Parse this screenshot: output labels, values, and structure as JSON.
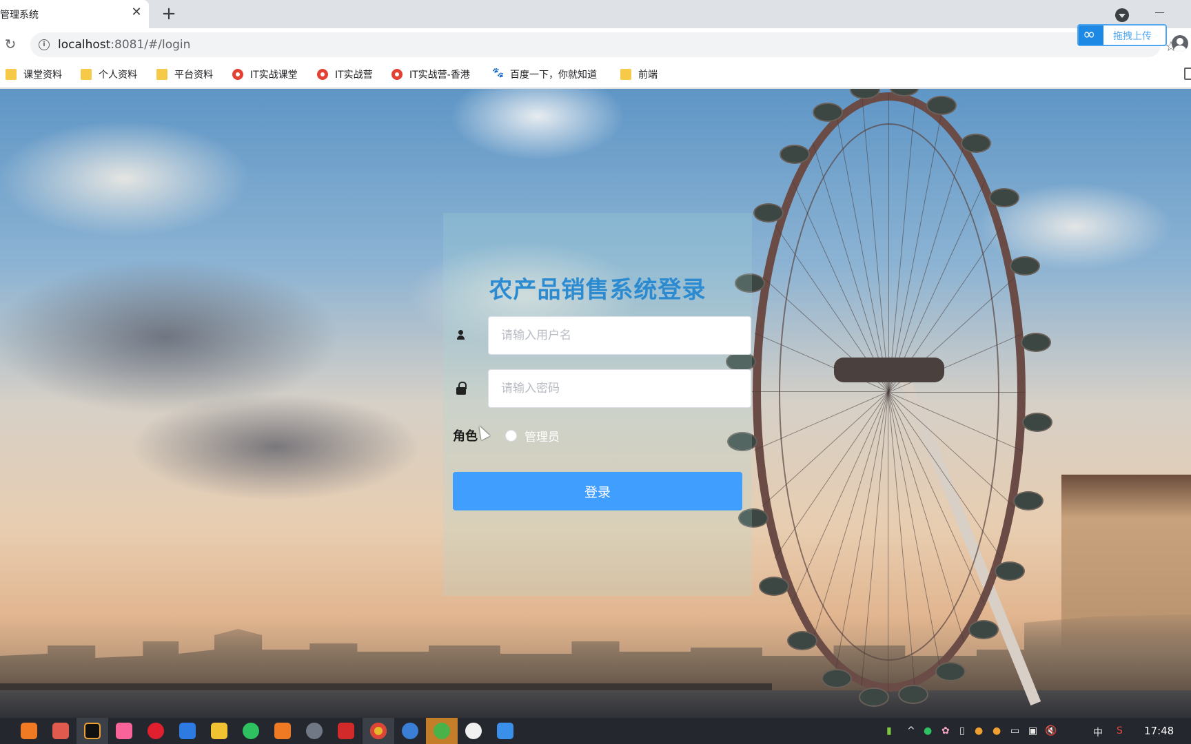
{
  "browser": {
    "tab_title": "管理系统",
    "tab_close": "✕",
    "new_tab": "+",
    "reload_glyph": "↻",
    "url_host": "localhost",
    "url_rest": ":8081/#/login",
    "star_glyph": "☆",
    "upload_widget_label": "拖拽上传",
    "bookmarks": [
      {
        "label": "课堂资料",
        "icon": "folder-icon"
      },
      {
        "label": "个人资料",
        "icon": "folder-icon"
      },
      {
        "label": "平台资料",
        "icon": "folder-icon"
      },
      {
        "label": "IT实战课堂",
        "icon": "chrome-icon"
      },
      {
        "label": "IT实战营",
        "icon": "chrome-icon"
      },
      {
        "label": "IT实战营-香港",
        "icon": "chrome-icon"
      },
      {
        "label": "百度一下，你就知道",
        "icon": "paw-icon"
      },
      {
        "label": "前端",
        "icon": "folder-icon"
      }
    ]
  },
  "login": {
    "title": "农产品销售系统登录",
    "username_placeholder": "请输入用户名",
    "password_placeholder": "请输入密码",
    "role_label": "角色",
    "role_option": "管理员",
    "submit_label": "登录"
  },
  "taskbar": {
    "ime_label": "中",
    "clock": "17:48",
    "colors": {
      "accent": "#409eff",
      "title": "#2c8ad1",
      "taskbar": "#24272e"
    }
  }
}
